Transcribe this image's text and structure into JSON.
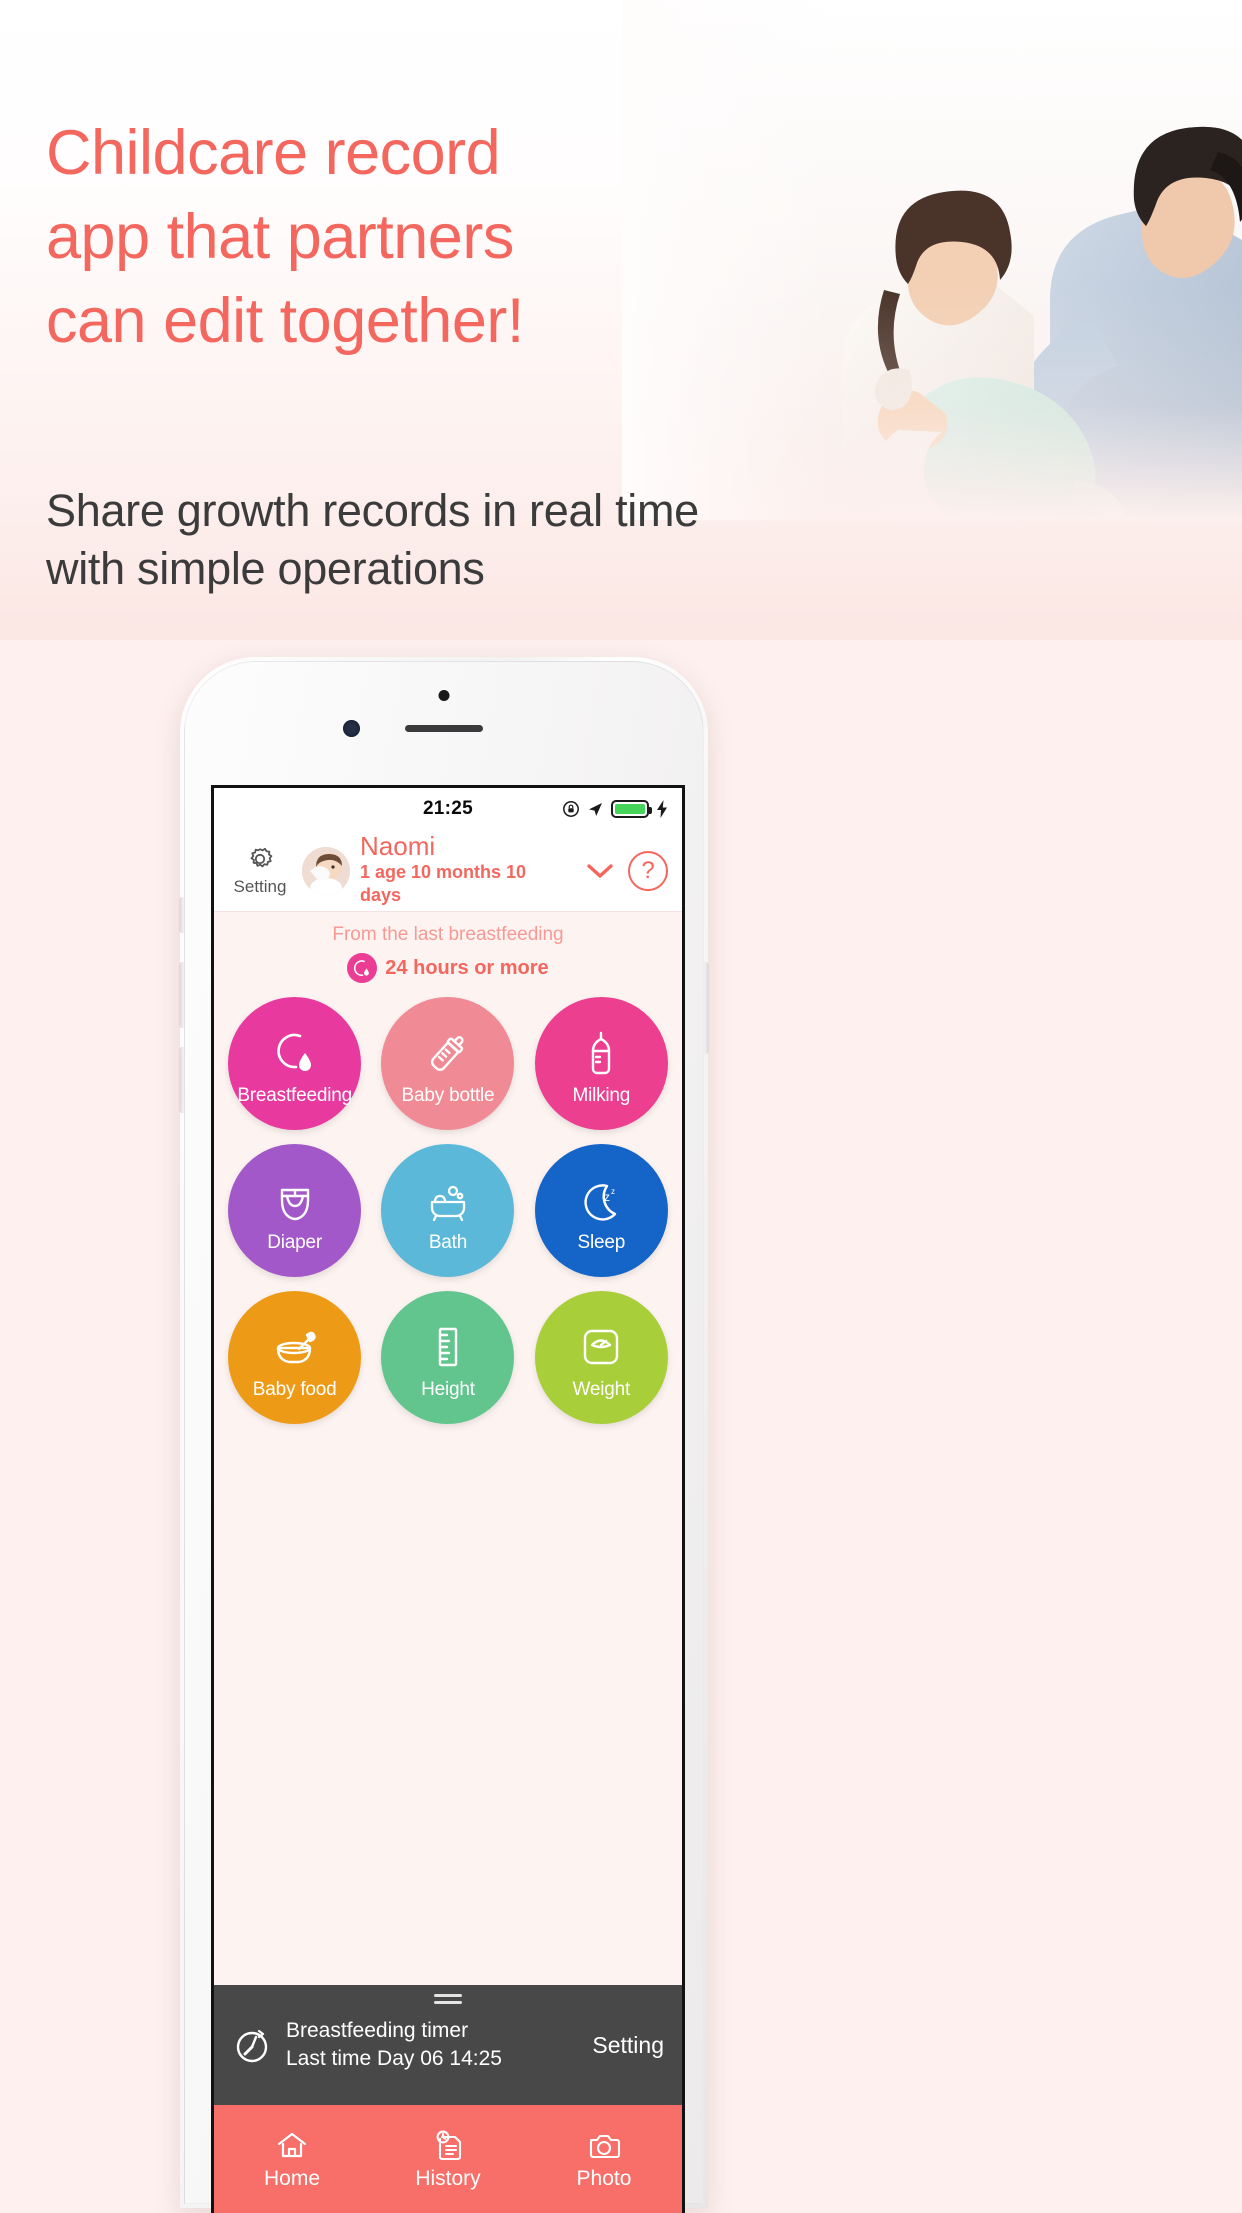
{
  "hero": {
    "headline": "Childcare record\napp that partners\ncan edit together!",
    "subheadline": "Share growth records in real time\nwith simple operations",
    "headline_color": "#f4675f",
    "subheadline_color": "#3b3b3b"
  },
  "phone": {
    "statusbar": {
      "clock": "21:25",
      "icons": [
        "rotation-lock-icon",
        "location-arrow-icon",
        "battery-icon",
        "charging-bolt-icon"
      ],
      "battery_level": "100",
      "battery_color": "#46d55a"
    },
    "header": {
      "setting_label": "Setting",
      "setting_icon": "gear-icon",
      "avatar": "baby-avatar",
      "baby_name": "Naomi",
      "baby_age": "1 age 10 months 10 days",
      "chevron_icon": "chevron-down-icon",
      "help_label": "?",
      "accent_color": "#f4675f"
    },
    "status_panel": {
      "title": "From the last breastfeeding",
      "value": "24 hours or more",
      "badge_icon": "breastfeeding-icon",
      "badge_color": "#eb3d94",
      "title_color": "#f79a95",
      "value_color": "#f4675f"
    },
    "grid": [
      {
        "label": "Breastfeeding",
        "icon": "breastfeeding-icon",
        "color": "#e8399e"
      },
      {
        "label": "Baby bottle",
        "icon": "baby-bottle-icon",
        "color": "#f08a95"
      },
      {
        "label": "Milking",
        "icon": "milking-pump-icon",
        "color": "#ec3f8f"
      },
      {
        "label": "Diaper",
        "icon": "diaper-icon",
        "color": "#a358c9"
      },
      {
        "label": "Bath",
        "icon": "bathtub-icon",
        "color": "#5bb8d8"
      },
      {
        "label": "Sleep",
        "icon": "moon-sleep-icon",
        "color": "#1565c8"
      },
      {
        "label": "Baby food",
        "icon": "bowl-spoon-icon",
        "color": "#ed9a17"
      },
      {
        "label": "Height",
        "icon": "ruler-icon",
        "color": "#63c58e"
      },
      {
        "label": "Weight",
        "icon": "scale-icon",
        "color": "#a8ce3a"
      }
    ],
    "timer": {
      "icon": "stopwatch-icon",
      "title": "Breastfeeding timer",
      "last_time": "Last time Day 06 14:25",
      "setting_label": "Setting",
      "background": "#484848"
    },
    "tabbar": {
      "background": "#f86e68",
      "items": [
        {
          "label": "Home",
          "icon": "home-icon",
          "active": true
        },
        {
          "label": "History",
          "icon": "history-icon",
          "active": false
        },
        {
          "label": "Photo",
          "icon": "camera-icon",
          "active": false
        }
      ]
    }
  }
}
